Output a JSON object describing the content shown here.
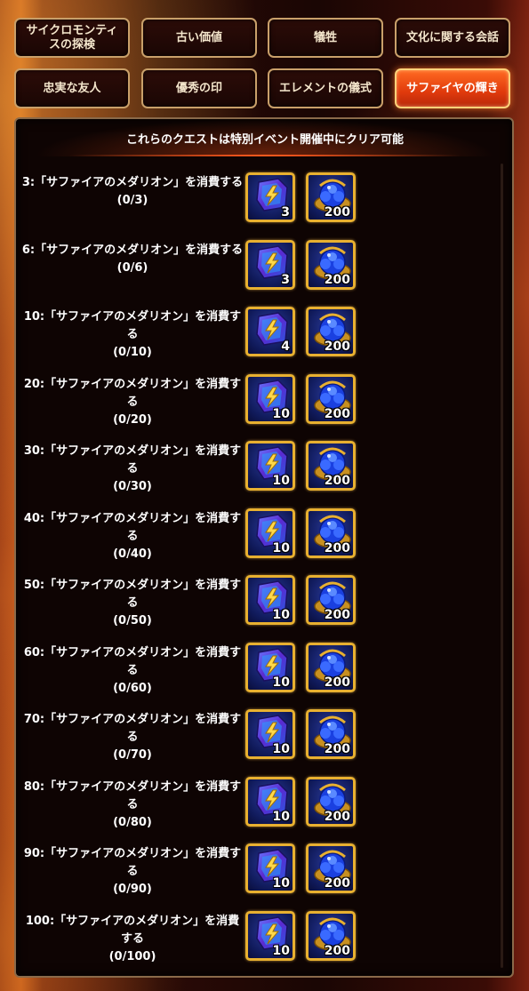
{
  "tabs": [
    {
      "label": "サイクロモンティスの探検",
      "active": false
    },
    {
      "label": "古い価値",
      "active": false
    },
    {
      "label": "犠牲",
      "active": false
    },
    {
      "label": "文化に関する会話",
      "active": false
    },
    {
      "label": "忠実な友人",
      "active": false
    },
    {
      "label": "優秀の印",
      "active": false
    },
    {
      "label": "エレメントの儀式",
      "active": false
    },
    {
      "label": "サファイヤの輝き",
      "active": true
    }
  ],
  "banner": "これらのクエストは特別イベント開催中にクリア可能",
  "quests": [
    {
      "title": "3:「サファイアのメダリオン」を消費する",
      "progress": "(0/3)",
      "reward_a": {
        "icon": "sapphire-medallion-icon",
        "qty": "3"
      },
      "reward_b": {
        "icon": "blue-gem-pile-icon",
        "qty": "200"
      }
    },
    {
      "title": "6:「サファイアのメダリオン」を消費する",
      "progress": "(0/6)",
      "reward_a": {
        "icon": "sapphire-medallion-icon",
        "qty": "3"
      },
      "reward_b": {
        "icon": "blue-gem-pile-icon",
        "qty": "200"
      }
    },
    {
      "title": "10:「サファイアのメダリオン」を消費する",
      "progress": "(0/10)",
      "reward_a": {
        "icon": "sapphire-medallion-icon",
        "qty": "4"
      },
      "reward_b": {
        "icon": "blue-gem-pile-icon",
        "qty": "200"
      }
    },
    {
      "title": "20:「サファイアのメダリオン」を消費する",
      "progress": "(0/20)",
      "reward_a": {
        "icon": "sapphire-medallion-icon",
        "qty": "10"
      },
      "reward_b": {
        "icon": "blue-gem-pile-icon",
        "qty": "200"
      }
    },
    {
      "title": "30:「サファイアのメダリオン」を消費する",
      "progress": "(0/30)",
      "reward_a": {
        "icon": "sapphire-medallion-icon",
        "qty": "10"
      },
      "reward_b": {
        "icon": "blue-gem-pile-icon",
        "qty": "200"
      }
    },
    {
      "title": "40:「サファイアのメダリオン」を消費する",
      "progress": "(0/40)",
      "reward_a": {
        "icon": "sapphire-medallion-icon",
        "qty": "10"
      },
      "reward_b": {
        "icon": "blue-gem-pile-icon",
        "qty": "200"
      }
    },
    {
      "title": "50:「サファイアのメダリオン」を消費する",
      "progress": "(0/50)",
      "reward_a": {
        "icon": "sapphire-medallion-icon",
        "qty": "10"
      },
      "reward_b": {
        "icon": "blue-gem-pile-icon",
        "qty": "200"
      }
    },
    {
      "title": "60:「サファイアのメダリオン」を消費する",
      "progress": "(0/60)",
      "reward_a": {
        "icon": "sapphire-medallion-icon",
        "qty": "10"
      },
      "reward_b": {
        "icon": "blue-gem-pile-icon",
        "qty": "200"
      }
    },
    {
      "title": "70:「サファイアのメダリオン」を消費する",
      "progress": "(0/70)",
      "reward_a": {
        "icon": "sapphire-medallion-icon",
        "qty": "10"
      },
      "reward_b": {
        "icon": "blue-gem-pile-icon",
        "qty": "200"
      }
    },
    {
      "title": "80:「サファイアのメダリオン」を消費する",
      "progress": "(0/80)",
      "reward_a": {
        "icon": "sapphire-medallion-icon",
        "qty": "10"
      },
      "reward_b": {
        "icon": "blue-gem-pile-icon",
        "qty": "200"
      }
    },
    {
      "title": "90:「サファイアのメダリオン」を消費する",
      "progress": "(0/90)",
      "reward_a": {
        "icon": "sapphire-medallion-icon",
        "qty": "10"
      },
      "reward_b": {
        "icon": "blue-gem-pile-icon",
        "qty": "200"
      }
    },
    {
      "title": "100:「サファイアのメダリオン」を消費する",
      "progress": "(0/100)",
      "reward_a": {
        "icon": "sapphire-medallion-icon",
        "qty": "10"
      },
      "reward_b": {
        "icon": "blue-gem-pile-icon",
        "qty": "200"
      }
    }
  ],
  "colors": {
    "accent": "#ff5a1e",
    "frame_gold": "#e8b030",
    "panel_bg": "#0e0403"
  }
}
